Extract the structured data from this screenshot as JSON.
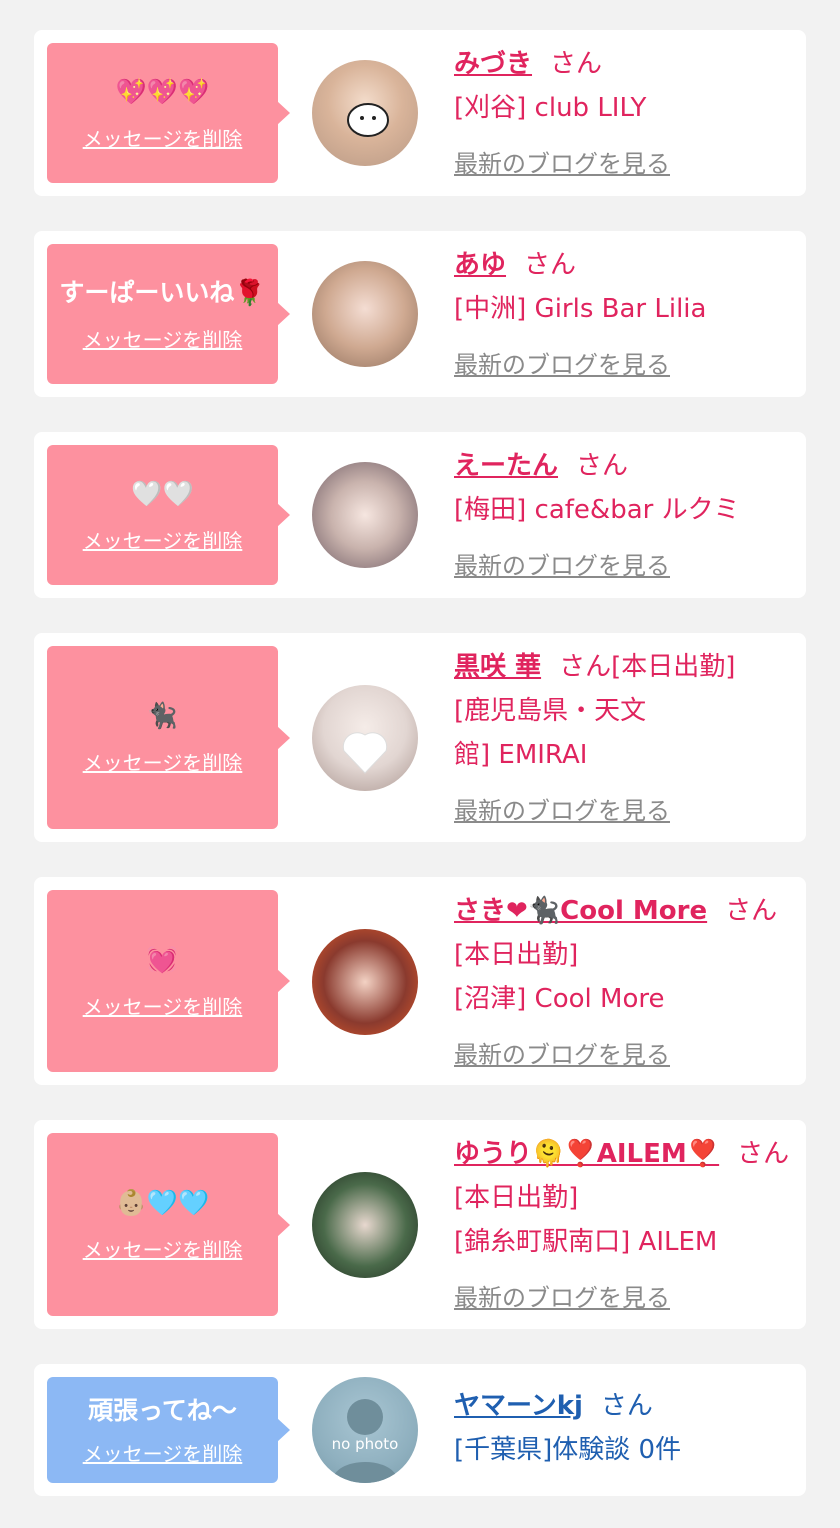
{
  "delete_label": "メッセージを削除",
  "blog_label": "最新のブログを見る",
  "san": "さん",
  "colors": {
    "pink": "#fd919f",
    "blue": "#8cb8f4",
    "name_pink": "#e0245e",
    "name_blue": "#1f5fb0"
  },
  "items": [
    {
      "message": "💖💖💖",
      "name": "みづき",
      "suffix": "さん",
      "shop": "[刈谷] club LILY"
    },
    {
      "message": "すーぱーいいね🌹",
      "name": "あゆ",
      "suffix": "さん",
      "shop": "[中洲] Girls Bar Lilia"
    },
    {
      "message": "🤍🤍",
      "name": "えーたん",
      "suffix": "さん",
      "shop": "[梅田] cafe&bar ルクミ"
    },
    {
      "message": "🐈‍⬛",
      "name": "黒咲 華",
      "suffix": "さん[本日出勤]",
      "shop": "[鹿児島県・天文館] EMIRAI"
    },
    {
      "message": "💓",
      "name": "さき❤︎🐈‍⬛Cool More",
      "suffix": "さん[本日出勤]",
      "shop": "[沼津] Cool More"
    },
    {
      "message": "👶🏼🩵🩵",
      "name": "ゆうり🫠❣️AILEM❣️",
      "suffix": "さん[本日出勤]",
      "shop": "[錦糸町駅南口] AILEM"
    },
    {
      "message": "頑張ってね〜",
      "name": "ヤマーンkj",
      "suffix": "さん",
      "shop": "[千葉県]体験談 0件",
      "avatar_text": "no photo"
    }
  ]
}
